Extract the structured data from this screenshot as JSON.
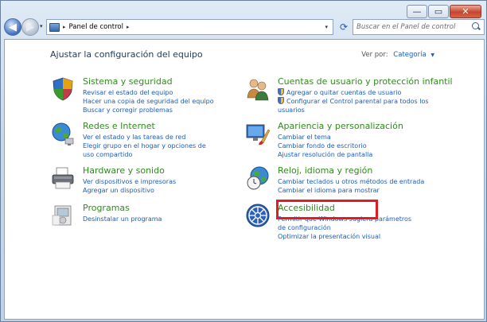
{
  "window": {
    "minimize": "—",
    "maximize": "▭",
    "close": "✕"
  },
  "nav": {
    "back_glyph": "◀",
    "forward_glyph": "▶",
    "history_dropdown": "▾",
    "address_path": [
      "Panel de control"
    ],
    "address_separator": "▸",
    "address_dropdown": "▾",
    "refresh_glyph": "⟳",
    "search_placeholder": "Buscar en el Panel de control"
  },
  "main": {
    "heading": "Ajustar la configuración del equipo",
    "view_by_label": "Ver por:",
    "view_by_value": "Categoría",
    "categories": [
      {
        "title": "Sistema y seguridad",
        "icon": "shield-check-icon",
        "links": [
          "Revisar el estado del equipo",
          "Hacer una copia de seguridad del equipo",
          "Buscar y corregir problemas"
        ]
      },
      {
        "title": "Redes e Internet",
        "icon": "network-globe-icon",
        "links": [
          "Ver el estado y las tareas de red",
          "Elegir grupo en el hogar y opciones de uso compartido"
        ]
      },
      {
        "title": "Hardware y sonido",
        "icon": "printer-icon",
        "links": [
          "Ver dispositivos e impresoras",
          "Agregar un dispositivo"
        ]
      },
      {
        "title": "Programas",
        "icon": "programs-icon",
        "links": [
          "Desinstalar un programa"
        ]
      },
      {
        "title": "Cuentas de usuario y protección infantil",
        "icon": "users-icon",
        "links": [
          "Agregar o quitar cuentas de usuario",
          "Configurar el Control parental para todos los usuarios"
        ]
      },
      {
        "title": "Apariencia y personalización",
        "icon": "display-brush-icon",
        "links": [
          "Cambiar el tema",
          "Cambiar fondo de escritorio",
          "Ajustar resolución de pantalla"
        ]
      },
      {
        "title": "Reloj, idioma y región",
        "icon": "clock-globe-icon",
        "links": [
          "Cambiar teclados u otros métodos de entrada",
          "Cambiar el idioma para mostrar"
        ]
      },
      {
        "title": "Accesibilidad",
        "icon": "accessibility-icon",
        "links": [
          "Permitir que Windows sugiera parámetros de configuración",
          "Optimizar la presentación visual"
        ]
      }
    ]
  },
  "colors": {
    "category_title": "#2f8d1c",
    "link": "#1c5dbd",
    "highlight": "#e31b23"
  }
}
